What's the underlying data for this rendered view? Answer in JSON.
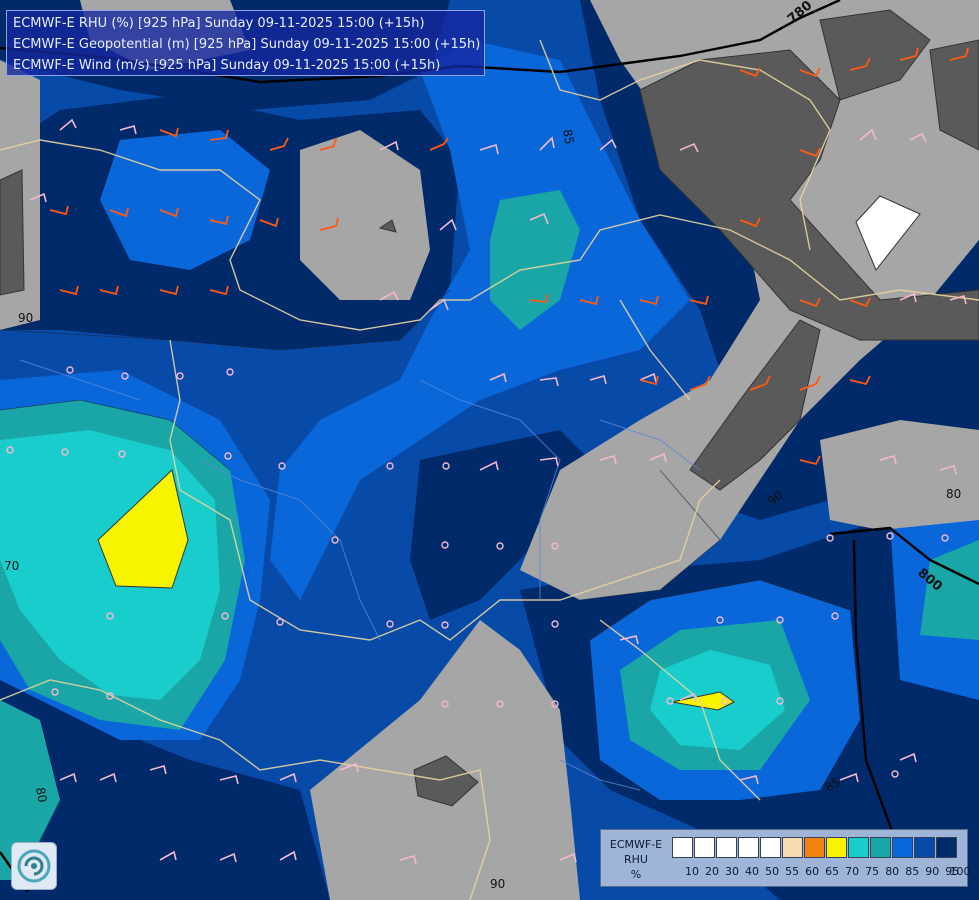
{
  "header": {
    "lines": [
      "ECMWF-E RHU (%) [925 hPa] Sunday 09-11-2025 15:00 (+15h)",
      "ECMWF-E Geopotential (m) [925 hPa] Sunday 09-11-2025 15:00 (+15h)",
      "ECMWF-E Wind (m/s) [925 hPa] Sunday 09-11-2025 15:00 (+15h)"
    ]
  },
  "contour_labels": {
    "geopotential": [
      "780",
      "800"
    ],
    "rhu": [
      "85",
      "90",
      "90",
      "70",
      "80",
      "80",
      "85",
      "90",
      "80",
      "90"
    ]
  },
  "legend": {
    "title_lines": [
      "ECMWF-E",
      "RHU",
      "%"
    ],
    "ticks": [
      "10",
      "20",
      "30",
      "40",
      "50",
      "55",
      "60",
      "65",
      "70",
      "75",
      "80",
      "85",
      "90",
      "95",
      "100"
    ],
    "colors": [
      "#ffffff",
      "#ffffff",
      "#ffffff",
      "#ffffff",
      "#ffffff",
      "#f7dcb0",
      "#f0820e",
      "#f8f400",
      "#19cdcd",
      "#1aa6a6",
      "#0a67da",
      "#084aa8",
      "#002a6a",
      "#a6a6a6",
      "#5a5a5a"
    ]
  },
  "colors": {
    "rhu_70_75": "#19cdcd",
    "rhu_75_80": "#1aa6a6",
    "rhu_80_85": "#0a67da",
    "rhu_85_90": "#084aa8",
    "rhu_90_95": "#002a6a",
    "rhu_95_100_light": "#a6a6a6",
    "rhu_95_100_dark": "#5a5a5a",
    "rhu_65_70": "#f8f400",
    "border": "#e8d4a0",
    "river": "#5a8ad8",
    "wind_orange": "#ff5a14",
    "wind_pink": "#f4b8d0"
  },
  "logo": {
    "icon": "ecmwf-swirl-logo"
  }
}
